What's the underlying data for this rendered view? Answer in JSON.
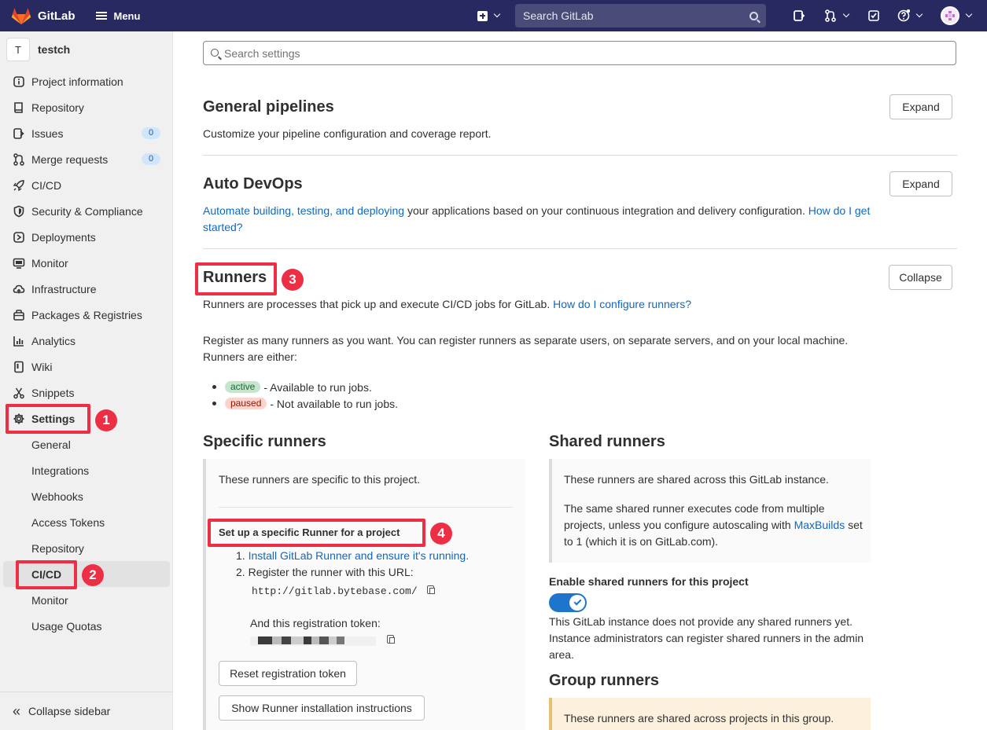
{
  "topbar": {
    "brand": "GitLab",
    "menu_label": "Menu",
    "search_placeholder": "Search GitLab"
  },
  "project": {
    "initial": "T",
    "name": "testch"
  },
  "sidebar": {
    "items": [
      {
        "label": "Project information",
        "icon": "info-icon"
      },
      {
        "label": "Repository",
        "icon": "book-icon"
      },
      {
        "label": "Issues",
        "icon": "issues-icon",
        "count": "0"
      },
      {
        "label": "Merge requests",
        "icon": "merge-request-icon",
        "count": "0"
      },
      {
        "label": "CI/CD",
        "icon": "rocket-icon"
      },
      {
        "label": "Security & Compliance",
        "icon": "shield-icon"
      },
      {
        "label": "Deployments",
        "icon": "deployments-icon"
      },
      {
        "label": "Monitor",
        "icon": "monitor-icon"
      },
      {
        "label": "Infrastructure",
        "icon": "cloud-icon"
      },
      {
        "label": "Packages & Registries",
        "icon": "package-icon"
      },
      {
        "label": "Analytics",
        "icon": "chart-icon"
      },
      {
        "label": "Wiki",
        "icon": "wiki-icon"
      },
      {
        "label": "Snippets",
        "icon": "snippet-icon"
      },
      {
        "label": "Settings",
        "icon": "gear-icon"
      }
    ],
    "settings_sub": [
      "General",
      "Integrations",
      "Webhooks",
      "Access Tokens",
      "Repository",
      "CI/CD",
      "Monitor",
      "Usage Quotas"
    ],
    "collapse_label": "Collapse sidebar"
  },
  "annotations": [
    "1",
    "2",
    "3",
    "4"
  ],
  "main": {
    "search_placeholder": "Search settings",
    "general_pipelines": {
      "title": "General pipelines",
      "desc": "Customize your pipeline configuration and coverage report.",
      "button": "Expand"
    },
    "auto_devops": {
      "title": "Auto DevOps",
      "link1": "Automate building, testing, and deploying",
      "desc": " your applications based on your continuous integration and delivery configuration. ",
      "link2": "How do I get started?",
      "button": "Expand"
    },
    "runners": {
      "title": "Runners",
      "button": "Collapse",
      "desc": "Runners are processes that pick up and execute CI/CD jobs for GitLab. ",
      "desc_link": "How do I configure runners?",
      "register_text": "Register as many runners as you want. You can register runners as separate users, on separate servers, and on your local machine. Runners are either:",
      "states": [
        {
          "badge": "active",
          "text": " - Available to run jobs."
        },
        {
          "badge": "paused",
          "text": " - Not available to run jobs."
        }
      ]
    },
    "specific": {
      "title": "Specific runners",
      "intro": "These runners are specific to this project.",
      "setup_title": "Set up a specific Runner for a project",
      "step1_link": "Install GitLab Runner and ensure it's running.",
      "step2": "Register the runner with this URL:",
      "url": "http://gitlab.bytebase.com/",
      "token_label": "And this registration token:",
      "reset_button": "Reset registration token",
      "show_button": "Show Runner installation instructions"
    },
    "shared": {
      "title": "Shared runners",
      "intro": "These runners are shared across this GitLab instance.",
      "desc": "The same shared runner executes code from multiple projects, unless you configure autoscaling with ",
      "desc_link": "MaxBuilds",
      "desc_end": " set to 1 (which it is on GitLab.com).",
      "enable_label": "Enable shared runners for this project",
      "enabled": true,
      "note": "This GitLab instance does not provide any shared runners yet. Instance administrators can register shared runners in the admin area."
    },
    "group": {
      "title": "Group runners",
      "intro": "These runners are shared across projects in this group."
    }
  }
}
